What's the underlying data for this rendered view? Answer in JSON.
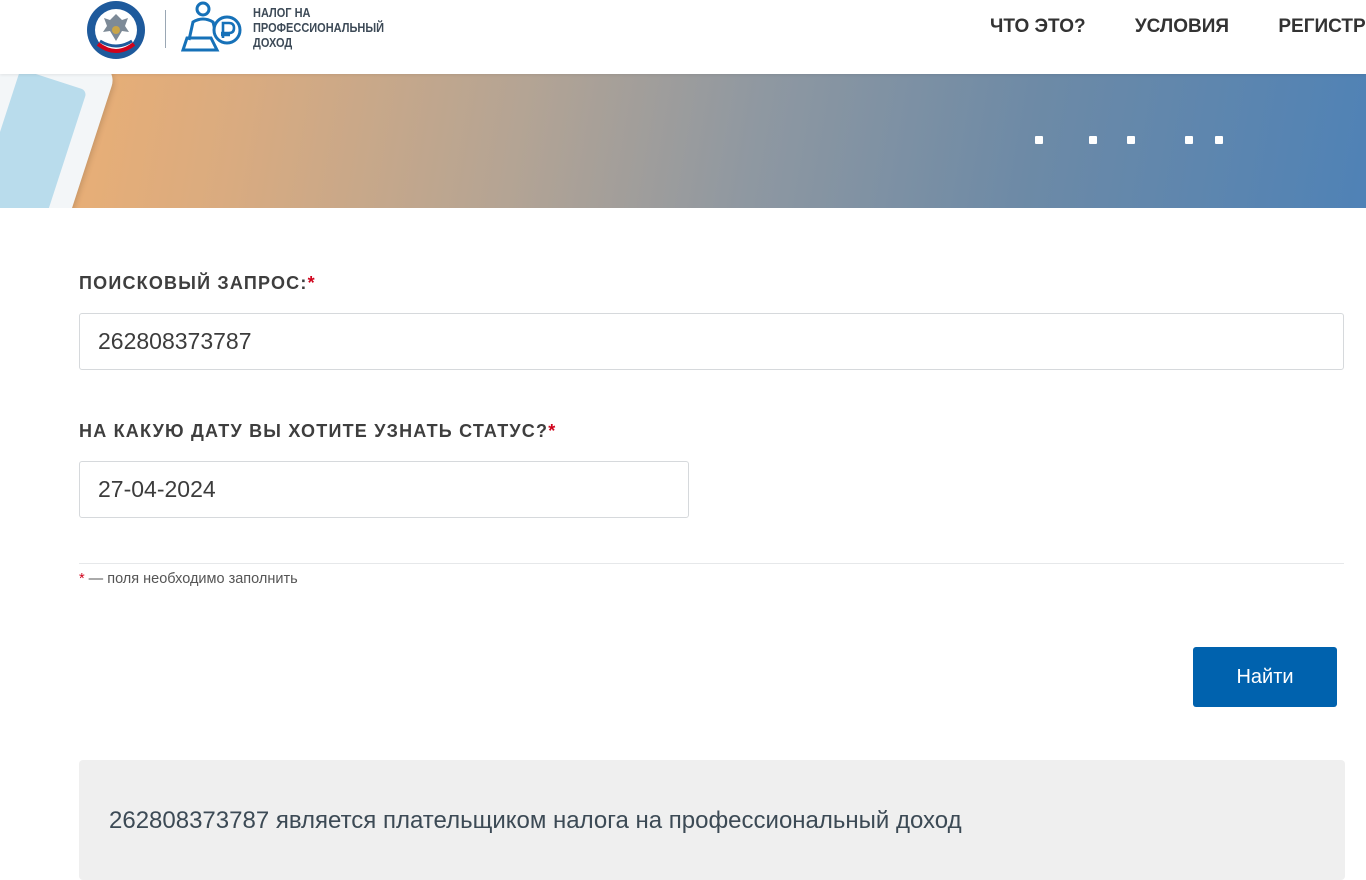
{
  "header": {
    "logo_fns_icon": "fns-emblem-icon",
    "logo_npd_icon": "self-employed-person-ruble-icon",
    "logo_text_lines": [
      "НАЛОГ НА",
      "ПРОФЕССИОНАЛЬНЫЙ",
      "ДОХОД"
    ],
    "nav": [
      "ЧТО ЭТО?",
      "УСЛОВИЯ",
      "РЕГИСТР"
    ]
  },
  "form": {
    "query_label": "ПОИСКОВЫЙ ЗАПРОС:",
    "query_required_mark": "*",
    "query_value": "262808373787",
    "date_label": "НА КАКУЮ ДАТУ ВЫ ХОТИТЕ УЗНАТЬ СТАТУС?",
    "date_required_mark": "*",
    "date_value": "27-04-2024",
    "required_note_mark": "*",
    "required_note": " — поля необходимо заполнить",
    "submit_label": "Найти"
  },
  "result": {
    "text": "262808373787 является плательщиком налога на профессиональный доход"
  },
  "colors": {
    "primary_button": "#0062ae",
    "required_mark": "#d0021b",
    "result_background": "#efefef"
  }
}
